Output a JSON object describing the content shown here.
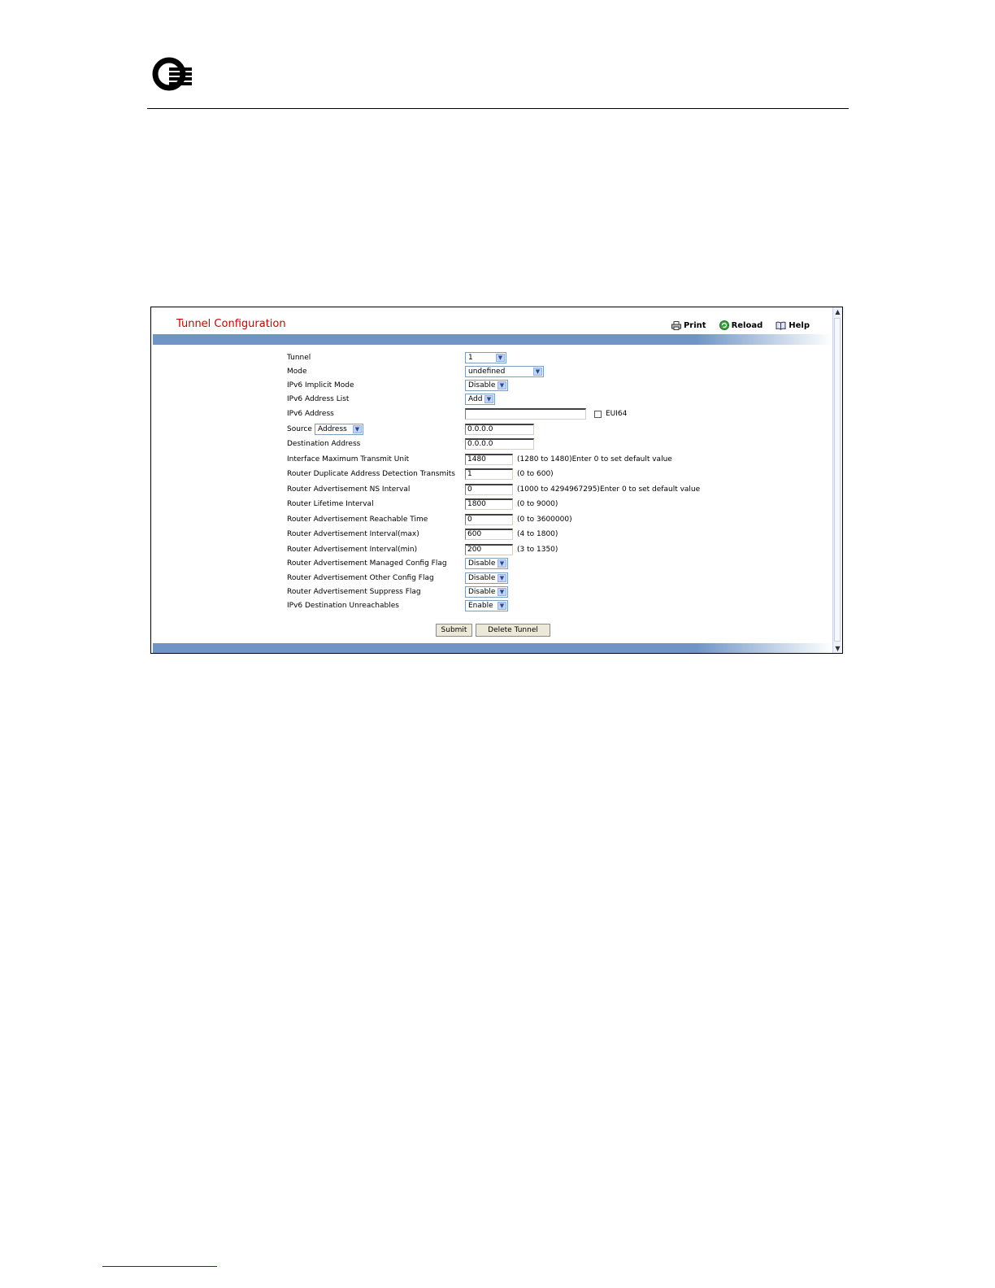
{
  "page": {
    "title": "Tunnel Configuration",
    "tools": [
      {
        "label": "Print",
        "icon": "printer-icon"
      },
      {
        "label": "Reload",
        "icon": "reload-icon"
      },
      {
        "label": "Help",
        "icon": "help-book-icon"
      }
    ]
  },
  "form": {
    "tunnel": {
      "label": "Tunnel",
      "value": "1"
    },
    "mode": {
      "label": "Mode",
      "value": "undefined"
    },
    "ipv6_implicit_mode": {
      "label": "IPv6 Implicit Mode",
      "value": "Disable"
    },
    "ipv6_address_list": {
      "label": "IPv6 Address List",
      "value": "Add"
    },
    "ipv6_address": {
      "label": "IPv6 Address",
      "value": "",
      "checkbox_label": "EUI64"
    },
    "source": {
      "label": "Source",
      "type": "Address",
      "value": "0.0.0.0"
    },
    "destination_address": {
      "label": "Destination Address",
      "value": "0.0.0.0"
    },
    "mtu": {
      "label": "Interface Maximum Transmit Unit",
      "value": "1480",
      "hint": "(1280 to 1480)Enter 0 to set default value"
    },
    "dad_transmits": {
      "label": "Router Duplicate Address Detection Transmits",
      "value": "1",
      "hint": "(0 to 600)"
    },
    "ns_interval": {
      "label": "Router Advertisement NS Interval",
      "value": "0",
      "hint": "(1000 to 4294967295)Enter 0 to set default value"
    },
    "lifetime": {
      "label": "Router Lifetime Interval",
      "value": "1800",
      "hint": "(0 to 9000)"
    },
    "reachable_time": {
      "label": "Router Advertisement Reachable Time",
      "value": "0",
      "hint": "(0 to 3600000)"
    },
    "interval_max": {
      "label": "Router Advertisement Interval(max)",
      "value": "600",
      "hint": "(4 to 1800)"
    },
    "interval_min": {
      "label": "Router Advertisement Interval(min)",
      "value": "200",
      "hint": "(3 to 1350)"
    },
    "managed_flag": {
      "label": "Router Advertisement Managed Config Flag",
      "value": "Disable"
    },
    "other_flag": {
      "label": "Router Advertisement Other Config Flag",
      "value": "Disable"
    },
    "suppress_flag": {
      "label": "Router Advertisement Suppress Flag",
      "value": "Disable"
    },
    "unreachables": {
      "label": "IPv6 Destination Unreachables",
      "value": "Enable"
    }
  },
  "buttons": {
    "submit": "Submit",
    "delete": "Delete Tunnel"
  },
  "colors": {
    "title": "#cc0000",
    "bar": "#6f95c7"
  }
}
